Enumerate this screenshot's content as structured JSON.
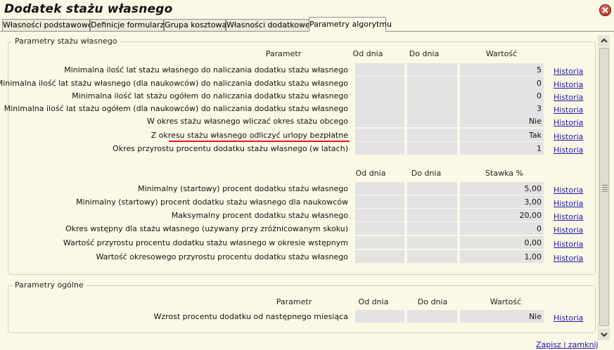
{
  "window": {
    "title": "Dodatek stażu własnego"
  },
  "tabs": [
    {
      "label": "Własności podstawowe"
    },
    {
      "label": "Definicje formularzy"
    },
    {
      "label": "Grupa kosztowa"
    },
    {
      "label": "Własności dodatkowe"
    },
    {
      "label": "Parametry algorytmu"
    }
  ],
  "section1": {
    "title": "Parametry stażu własnego",
    "headers": {
      "param": "Parametr",
      "from": "Od dnia",
      "to": "Do dnia",
      "value": "Wartość"
    },
    "rows": [
      {
        "label": "Minimalna ilość lat stażu własnego do naliczania dodatku stażu własnego",
        "value": "5",
        "link": "Historia"
      },
      {
        "label": "Minimalna ilość lat stażu własnego (dla naukowców) do naliczania dodatku stażu własnego",
        "value": "0",
        "link": "Historia"
      },
      {
        "label": "Minimalna ilość lat stażu ogółem do naliczania dodatku stażu własnego",
        "value": "0",
        "link": "Historia"
      },
      {
        "label": "Minimalna ilość lat stażu ogółem (dla naukowców) do naliczania dodatku stażu własnego",
        "value": "3",
        "link": "Historia"
      },
      {
        "label": "W okres stażu własnego wliczać okres stażu obcego",
        "value": "Nie",
        "link": "Historia"
      },
      {
        "label": "Z okresu stażu własnego odliczyć urlopy bezpłatne",
        "value": "Tak",
        "link": "Historia"
      },
      {
        "label": "Okres przyrostu procentu dodatku stażu własnego (w latach)",
        "value": "1",
        "link": "Historia"
      }
    ],
    "headers2": {
      "from": "Od dnia",
      "to": "Do dnia",
      "rate": "Stawka %"
    },
    "rows2": [
      {
        "label": "Minimalny (startowy) procent dodatku stażu własnego",
        "value": "5,00",
        "link": "Historia"
      },
      {
        "label": "Minimalny (startowy) procent dodatku stażu własnego dla naukowców",
        "value": "3,00",
        "link": "Historia"
      },
      {
        "label": "Maksymalny procent dodatku stażu własnego",
        "value": "20,00",
        "link": "Historia"
      },
      {
        "label": "Okres wstępny dla stażu własnego (używany przy zróżnicowanym skoku)",
        "value": "0",
        "link": "Historia"
      },
      {
        "label": "Wartość przyrostu procentu dodatku stażu własnego w okresie wstępnym",
        "value": "0,00",
        "link": "Historia"
      },
      {
        "label": "Wartość okresowego przyrostu procentu dodatku stażu własnego",
        "value": "1,00",
        "link": "Historia"
      }
    ]
  },
  "section2": {
    "title": "Parametry ogólne",
    "headers": {
      "param": "Parametr",
      "from": "Od dnia",
      "to": "Do dnia",
      "value": "Wartość"
    },
    "rows": [
      {
        "label": "Wzrost procentu dodatku od następnego miesiąca",
        "value": "Nie",
        "link": "Historia"
      }
    ]
  },
  "footer": {
    "save_close": "Zapisz i zamknij"
  },
  "colors": {
    "background": "#fbf8e6",
    "link": "#1a1ab0",
    "highlight_underline": "#e21b1b",
    "cell": "#e3e3e3"
  }
}
